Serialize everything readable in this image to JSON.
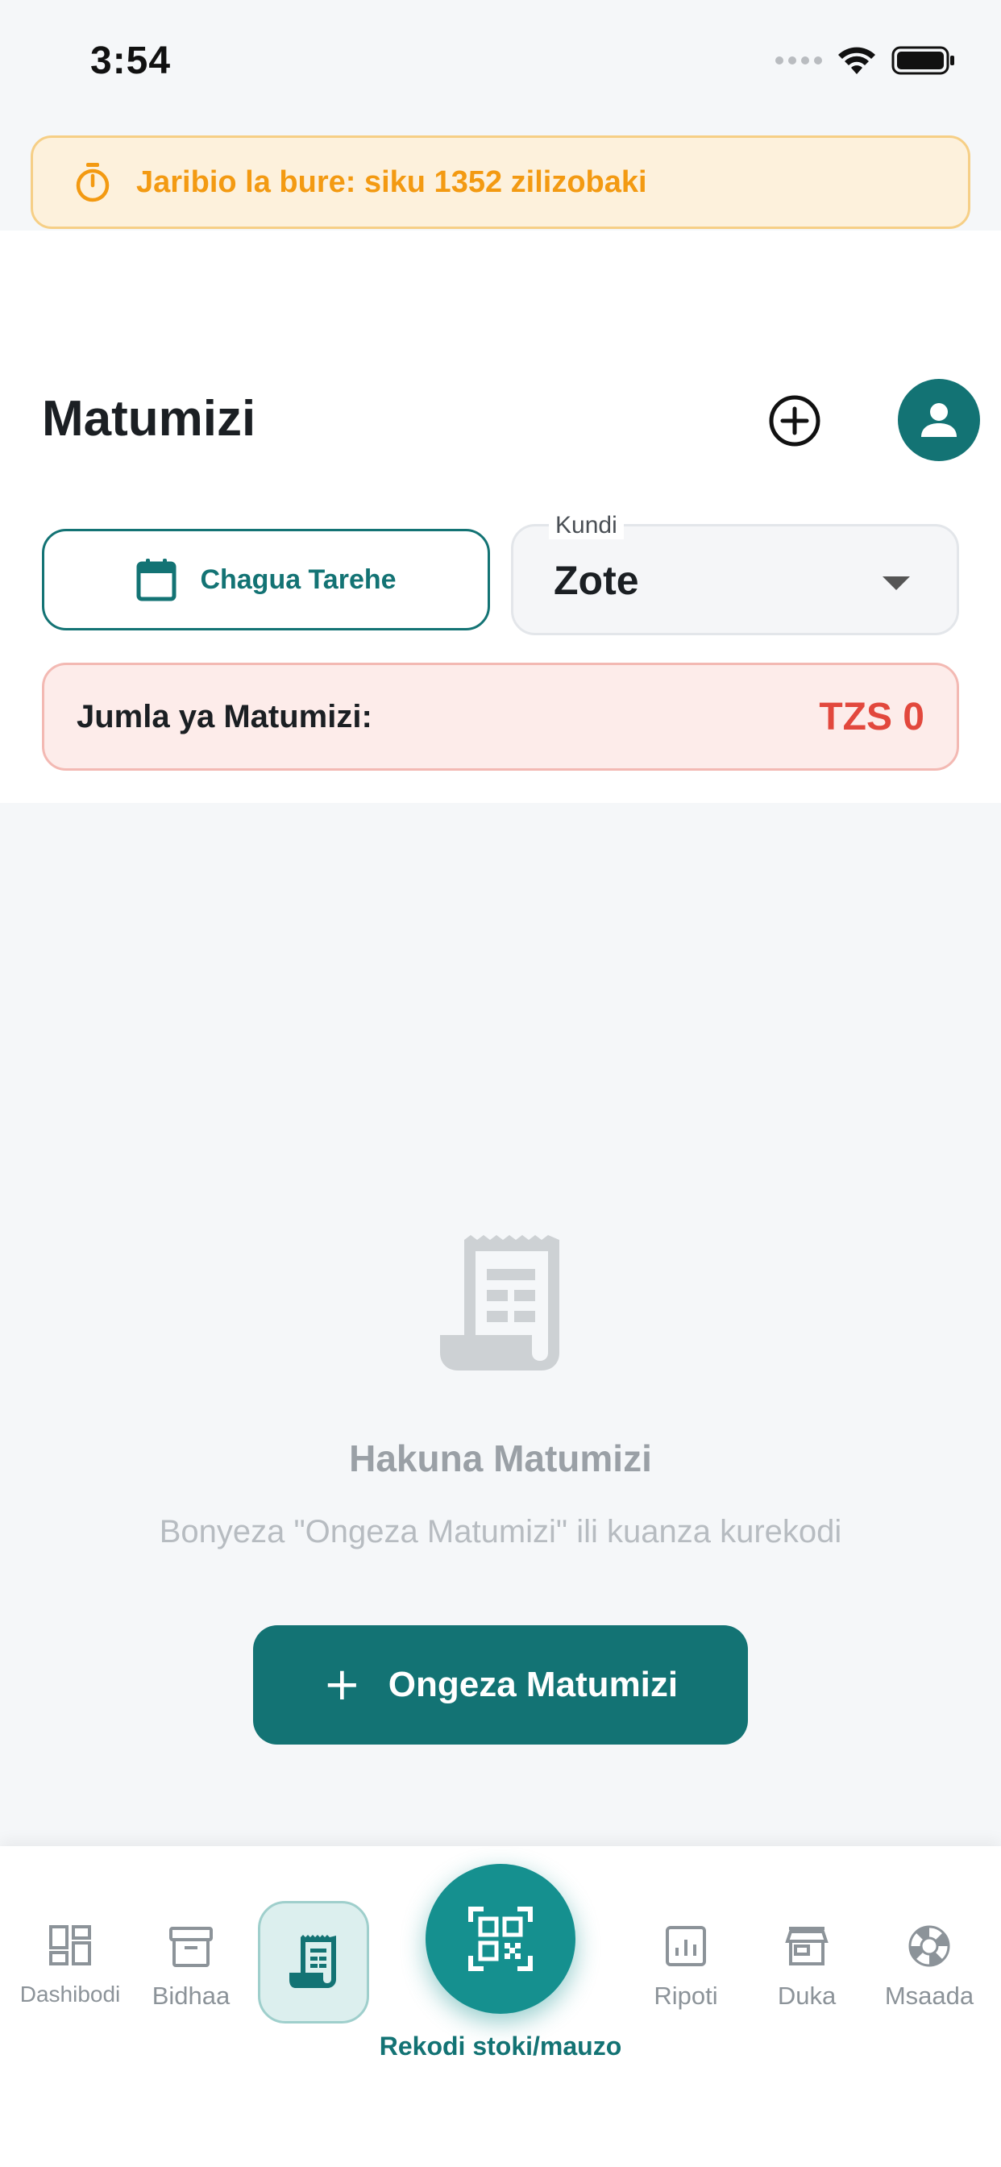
{
  "status_bar": {
    "time": "3:54"
  },
  "trial_banner": {
    "text": "Jaribio la bure: siku 1352 zilizobaki"
  },
  "header": {
    "title": "Matumizi"
  },
  "filters": {
    "date_button_label": "Chagua Tarehe",
    "category_label": "Kundi",
    "category_value": "Zote"
  },
  "summary": {
    "label": "Jumla ya Matumizi:",
    "value": "TZS 0"
  },
  "empty_state": {
    "title": "Hakuna Matumizi",
    "subtitle": "Bonyeza \"Ongeza Matumizi\" ili kuanza kurekodi",
    "button_label": "Ongeza Matumizi"
  },
  "bottom_nav": {
    "items": [
      {
        "label": "Dashibodi",
        "icon": "dashboard-icon"
      },
      {
        "label": "Bidhaa",
        "icon": "archive-box-icon"
      },
      {
        "label": "",
        "icon": "receipt-icon",
        "active": true
      },
      {
        "label": "Ripoti",
        "icon": "report-chart-icon"
      },
      {
        "label": "Duka",
        "icon": "store-icon"
      },
      {
        "label": "Msaada",
        "icon": "help-lifebuoy-icon"
      }
    ],
    "fab_label": "Rekodi stoki/mauzo"
  },
  "colors": {
    "primary": "#137374",
    "accent_teal": "#15908f",
    "warning": "#f39a12",
    "danger": "#e2483d"
  }
}
